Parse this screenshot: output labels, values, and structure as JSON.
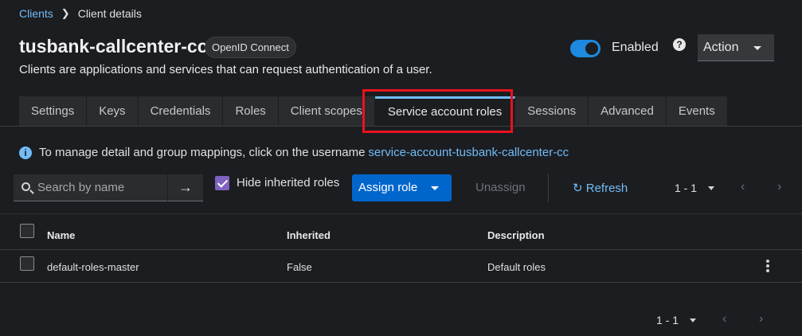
{
  "breadcrumb": {
    "parent": "Clients",
    "current": "Client details"
  },
  "header": {
    "title": "tusbank-callcenter-cc",
    "badge": "OpenID Connect",
    "subtitle": "Clients are applications and services that can request authentication of a user.",
    "toggle_label": "Enabled",
    "toggle_on": true,
    "action_label": "Action"
  },
  "tabs": [
    {
      "label": "Settings"
    },
    {
      "label": "Keys"
    },
    {
      "label": "Credentials"
    },
    {
      "label": "Roles"
    },
    {
      "label": "Client scopes"
    },
    {
      "label": "Service account roles",
      "active": true
    },
    {
      "label": "Sessions"
    },
    {
      "label": "Advanced"
    },
    {
      "label": "Events"
    }
  ],
  "info": {
    "text": "To manage detail and group mappings, click on the username",
    "link": "service-account-tusbank-callcenter-cc"
  },
  "toolbar": {
    "search_placeholder": "Search by name",
    "hide_inherited_label": "Hide inherited roles",
    "hide_inherited_checked": true,
    "assign_label": "Assign role",
    "unassign_label": "Unassign",
    "refresh_label": "Refresh",
    "pagination": "1 - 1"
  },
  "table": {
    "columns": [
      "Name",
      "Inherited",
      "Description"
    ],
    "rows": [
      {
        "name": "default-roles-master",
        "inherited": "False",
        "description": "Default roles"
      }
    ]
  },
  "footer": {
    "pagination": "1 - 1"
  },
  "colors": {
    "accent": "#73bcf7",
    "primary": "#0066cc",
    "highlight": "#e8121e",
    "background": "#1b1d21"
  }
}
